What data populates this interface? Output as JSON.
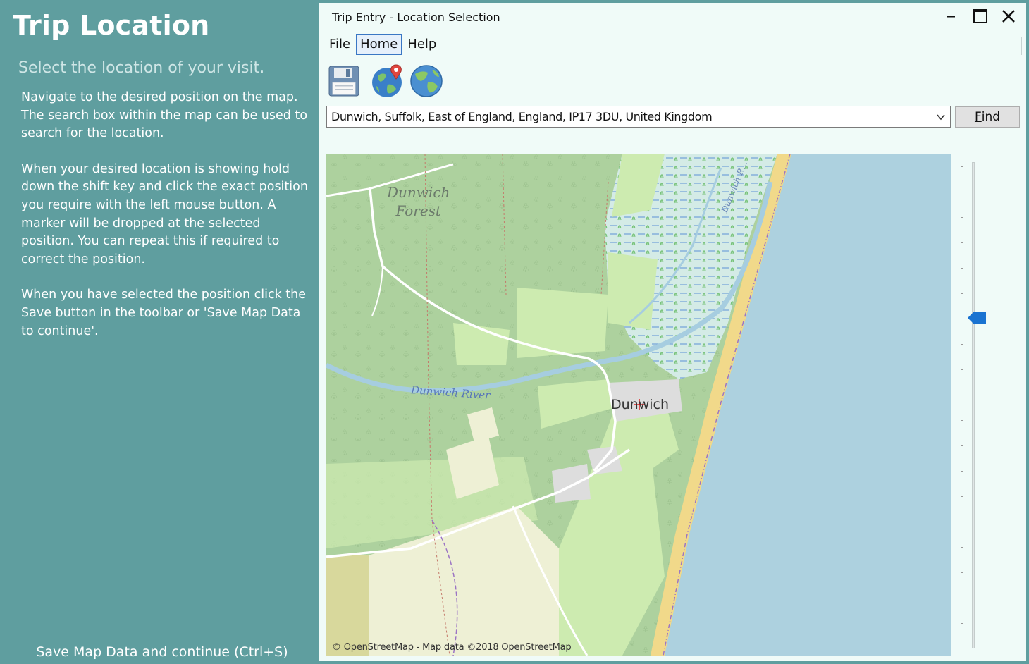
{
  "help_panel": {
    "title": "Trip Location",
    "subtitle": "Select the location of your visit.",
    "paragraph_1": "Navigate to the desired position on the map. The search box within the map can be used to search for the location.",
    "paragraph_2": "When your desired location is showing hold down the shift key and click the exact position you require with the left mouse button. A marker will be dropped at the selected position. You can repeat this if required to correct the position.",
    "paragraph_3": "When you have selected the position click the Save button in the toolbar or 'Save Map Data to continue'.",
    "save_link": "Save Map Data and continue (Ctrl+S)"
  },
  "window": {
    "title": "Trip Entry - Location Selection"
  },
  "menu": {
    "items": [
      {
        "label": "File",
        "accel": "F",
        "rest": "ile",
        "active": false
      },
      {
        "label": "Home",
        "accel": "H",
        "rest": "ome",
        "active": true
      },
      {
        "label": "Help",
        "accel": "H",
        "rest": "elp",
        "active": false
      }
    ]
  },
  "toolbar": {
    "icons": [
      "save-icon",
      "globe-pin-icon",
      "globe-icon"
    ]
  },
  "search": {
    "selected_location": "Dunwich, Suffolk, East of England, England, IP17 3DU, United Kingdom",
    "find_label": "Find",
    "find_accel": "F",
    "find_rest": "ind"
  },
  "map": {
    "forest_label_line1": "Dunwich",
    "forest_label_line2": "Forest",
    "river_label": "Dunwich River",
    "road_label": "Dunwich R...",
    "town_label": "Dunwich",
    "attribution": "© OpenStreetMap - Map data ©2018 OpenStreetMap",
    "colors": {
      "sea": "#add1df",
      "forest": "#add19e",
      "farmland": "#eef0d5",
      "grass": "#cdebb0",
      "marsh": "#d4ebe6",
      "beach": "#f1d98a",
      "river": "#a6cde0"
    }
  },
  "zoom": {
    "level_fraction": 0.32
  },
  "theme": {
    "panel_bg": "#5f9e9f",
    "window_bg": "#f0fbf8",
    "accent": "#1a73d1"
  }
}
